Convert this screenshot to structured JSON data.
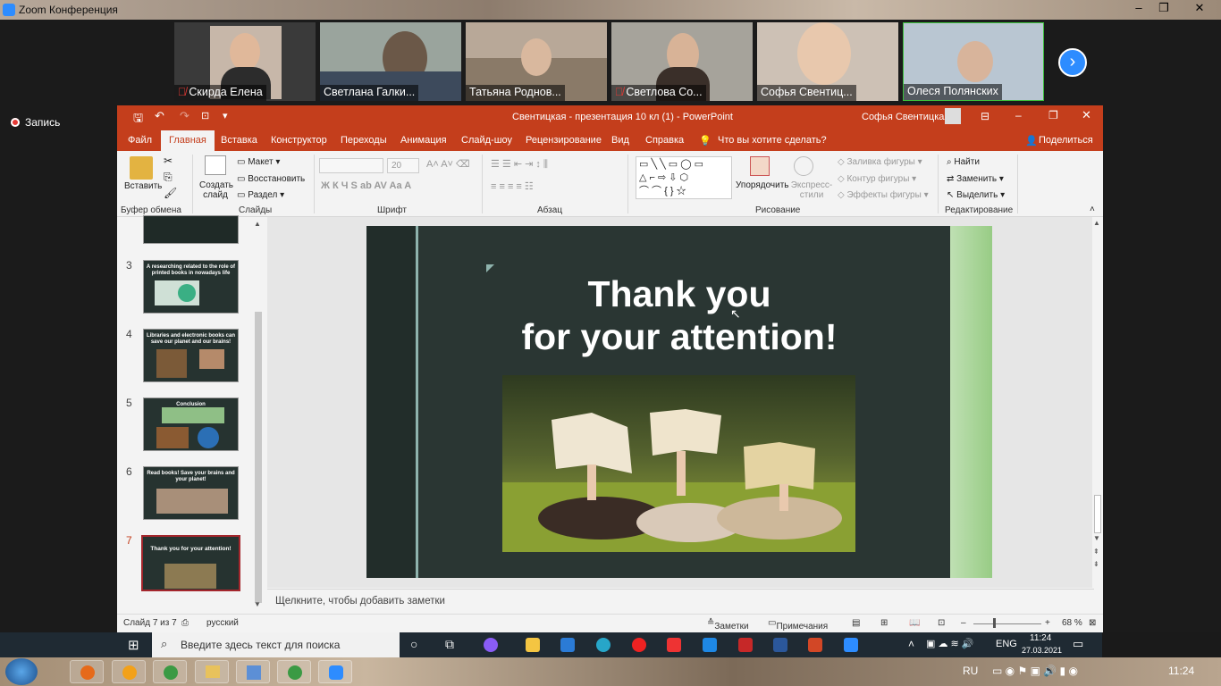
{
  "zoom": {
    "title": "Zoom Конференция",
    "record": "Запись",
    "participants": [
      {
        "name": "Скирда Елена",
        "muted": true
      },
      {
        "name": "Светлана Галки...",
        "muted": false
      },
      {
        "name": "Татьяна Роднов...",
        "muted": false
      },
      {
        "name": "Светлова Со...",
        "muted": true
      },
      {
        "name": "Софья Свентиц...",
        "muted": false
      },
      {
        "name": "Олеся Полянских",
        "muted": false
      }
    ],
    "next_icon": "chevron-right-icon"
  },
  "ppt": {
    "window_title": "Свентицкая - презентация 10 кл (1)  -  PowerPoint",
    "user": "Софья Свентицкая",
    "tabs": [
      "Файл",
      "Главная",
      "Вставка",
      "Конструктор",
      "Переходы",
      "Анимация",
      "Слайд-шоу",
      "Рецензирование",
      "Вид",
      "Справка"
    ],
    "tell_me": "Что вы хотите сделать?",
    "share": "Поделиться",
    "ribbon": {
      "paste": "Вставить",
      "clipboard": "Буфер обмена",
      "new_slide": "Создать слайд",
      "layout": "Макет",
      "reset": "Восстановить",
      "section": "Раздел",
      "slides": "Слайды",
      "font": "Шрифт",
      "font_size": "20",
      "paragraph": "Абзац",
      "arrange": "Упорядочить",
      "quick_styles": "Экспресс-стили",
      "shape_fill": "Заливка фигуры",
      "shape_outline": "Контур фигуры",
      "shape_effects": "Эффекты фигуры",
      "drawing": "Рисование",
      "find": "Найти",
      "replace": "Заменить",
      "select": "Выделить",
      "editing": "Редактирование"
    },
    "thumbnails": [
      {
        "num": "3",
        "text": "A researching related to the role of printed books in nowadays life"
      },
      {
        "num": "4",
        "text": "Libraries and electronic books can save our planet and our brains!"
      },
      {
        "num": "5",
        "text": "Conclusion"
      },
      {
        "num": "6",
        "text": "Read books! Save your brains and your planet!"
      },
      {
        "num": "7",
        "text": "Thank you for your attention!"
      }
    ],
    "slide": {
      "title_line1": "Thank you",
      "title_line2": "for your attention!"
    },
    "notes_placeholder": "Щелкните, чтобы добавить заметки",
    "status": {
      "slide": "Слайд 7 из 7",
      "lang": "русский",
      "notes": "Заметки",
      "comments": "Примечания",
      "zoom": "68 %"
    }
  },
  "taskbar": {
    "search": "Введите здесь текст для поиска",
    "lang": "ENG",
    "time": "11:24",
    "date": "27.03.2021"
  },
  "win7": {
    "lang": "RU",
    "time": "11:24"
  },
  "colors": {
    "ppt_accent": "#c43e1c",
    "zoom_blue": "#2d8cff"
  }
}
